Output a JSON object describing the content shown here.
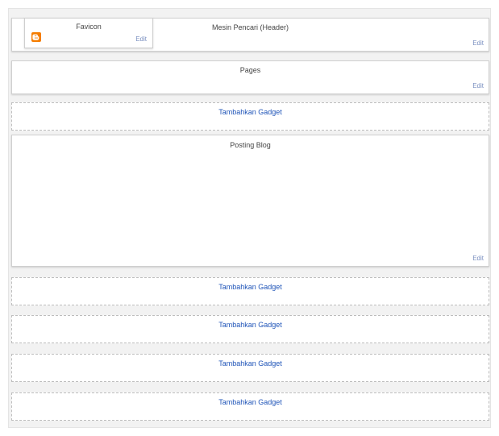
{
  "header": {
    "title": "Mesin Pencari (Header)",
    "edit_label": "Edit",
    "favicon": {
      "title": "Favicon",
      "edit_label": "Edit",
      "icon": "blogger-icon",
      "icon_color": "#f57d00"
    }
  },
  "pages": {
    "title": "Pages",
    "edit_label": "Edit"
  },
  "add_gadget_label": "Tambahkan Gadget",
  "blog_posts": {
    "title": "Posting Blog",
    "edit_label": "Edit"
  },
  "colors": {
    "link": "#1f54b8",
    "edit": "#7a8fc0",
    "icon": "#f57d00"
  }
}
